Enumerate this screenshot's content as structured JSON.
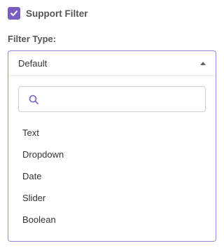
{
  "support_filter": {
    "label": "Support Filter",
    "checked": true
  },
  "filter_type": {
    "label": "Filter Type:",
    "selected": "Default",
    "search_placeholder": "",
    "options": [
      "Text",
      "Dropdown",
      "Date",
      "Slider",
      "Boolean"
    ]
  },
  "colors": {
    "accent": "#7c5cbf",
    "border": "#9c83d2"
  },
  "icons": {
    "check": "check-icon",
    "search": "search-icon",
    "caret": "caret-up-icon"
  }
}
